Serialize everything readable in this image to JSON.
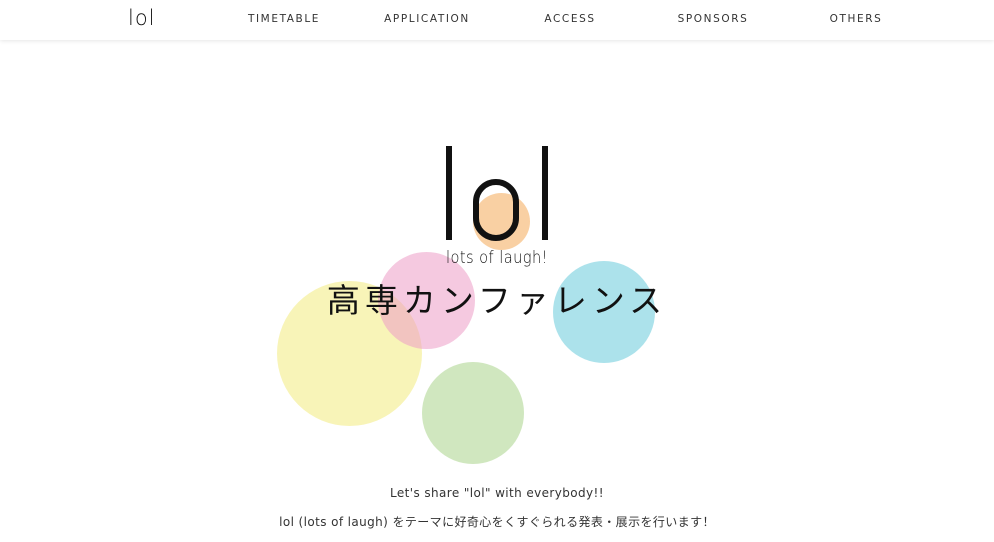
{
  "nav": {
    "logo": "lol",
    "links": [
      "TIMETABLE",
      "APPLICATION",
      "ACCESS",
      "SPONSORS",
      "OTHERS"
    ]
  },
  "hero": {
    "logo": "lol",
    "subtitle": "lots of laugh!",
    "title": "高専カンファレンス",
    "circle_colors": {
      "yellow": "#f6f0a0",
      "pink": "#ec9dc7",
      "blue": "#79d0de",
      "green": "#a9d38a",
      "orange": "#f5b36a"
    }
  },
  "content": {
    "line1": "Let's share \"lol\" with everybody!!",
    "line2": "lol (lots of laugh) をテーマに好奇心をくすぐられる発表・展示を行います！",
    "line3": "・・・・・・・・"
  }
}
